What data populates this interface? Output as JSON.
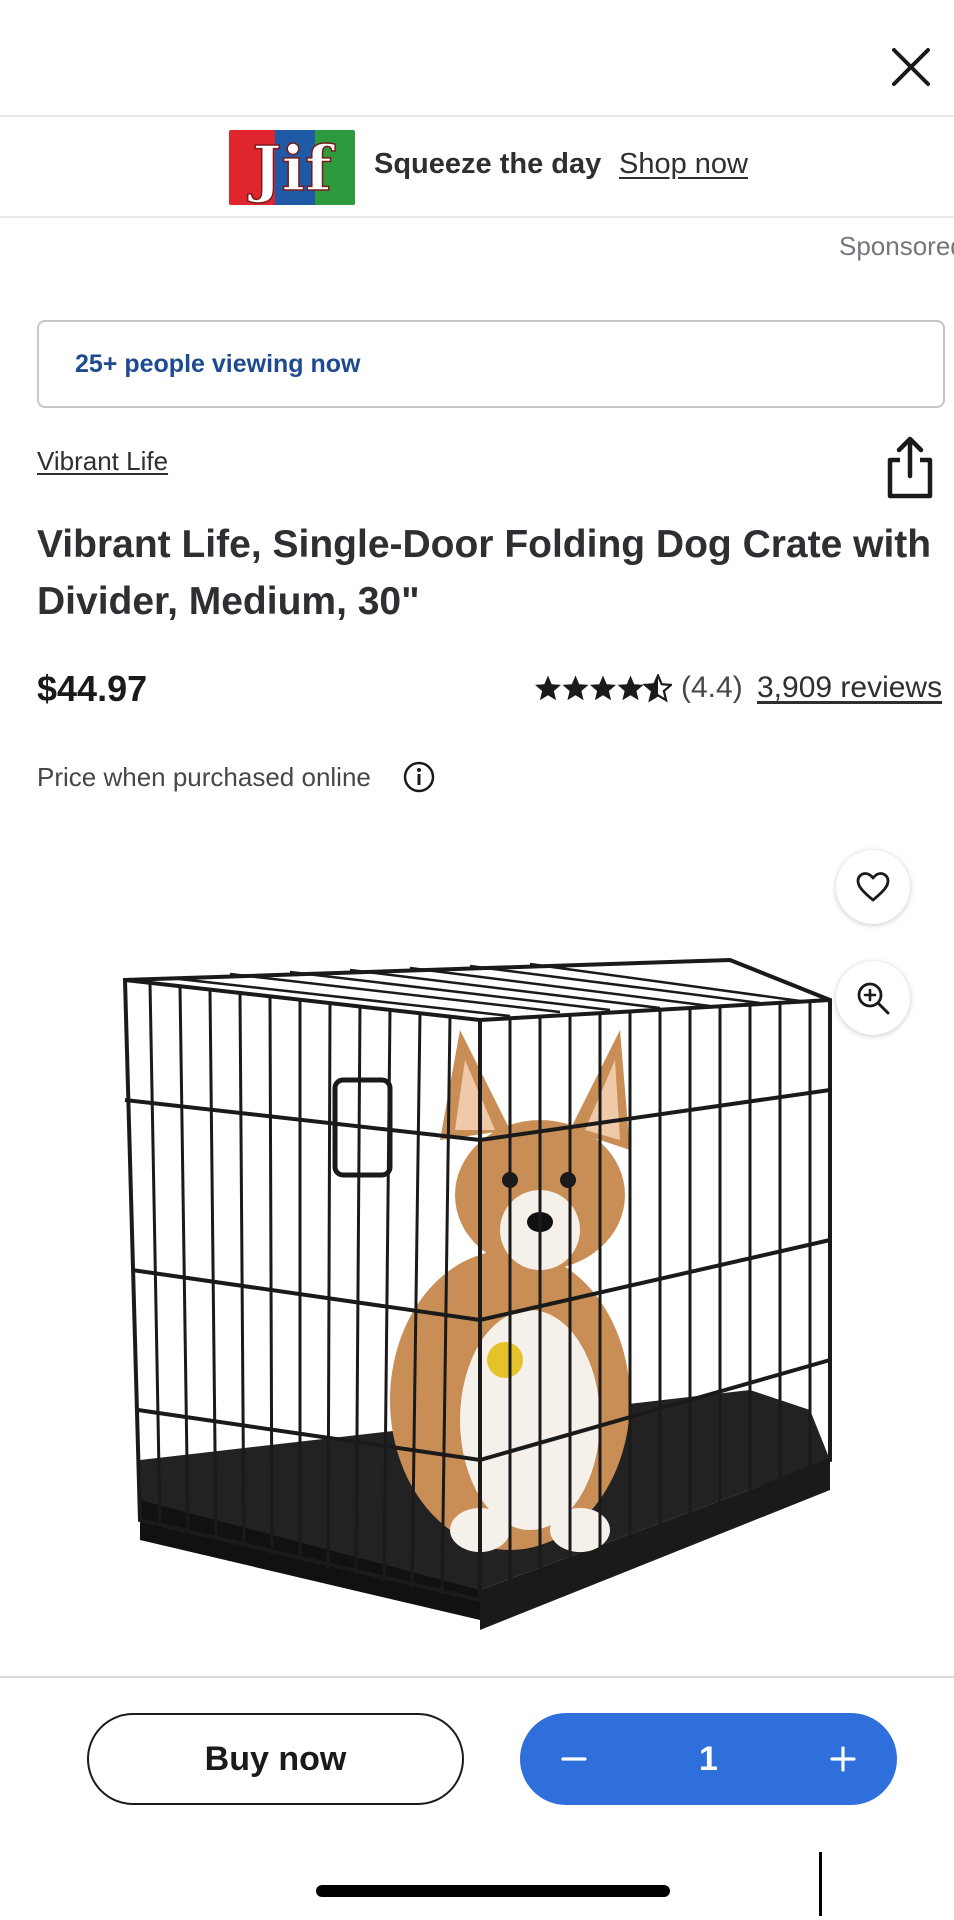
{
  "topbar": {
    "close_icon": "close-icon"
  },
  "ad": {
    "logo_text": "Jif",
    "tagline": "Squeeze the day",
    "link_text": "Shop now",
    "sponsored_label": "Sponsored",
    "logo_colors": {
      "red": "#e0252f",
      "blue": "#1f5aa6",
      "green": "#2e9a3e"
    }
  },
  "viewing": {
    "text": "25+ people viewing now"
  },
  "product": {
    "brand": "Vibrant Life",
    "title": "Vibrant Life, Single-Door Folding Dog Crate with Divider, Medium, 30\"",
    "price": "$44.97",
    "rating_value": 4.4,
    "rating_display": "(4.4)",
    "reviews_text": "3,909 reviews",
    "price_note": "Price when purchased online",
    "image_alt": "Dog crate with corgi",
    "icons": {
      "share": "share-icon",
      "info": "info-icon",
      "favorite": "heart-icon",
      "zoom": "zoom-in-icon"
    }
  },
  "actions": {
    "buy_now_label": "Buy now",
    "quantity": "1",
    "minus_icon": "minus-icon",
    "plus_icon": "plus-icon"
  },
  "colors": {
    "accent_blue": "#2e6fdb",
    "viewing_text_blue": "#1e4b8f",
    "text_primary": "#2e2f32",
    "divider": "#e6e7e8"
  }
}
